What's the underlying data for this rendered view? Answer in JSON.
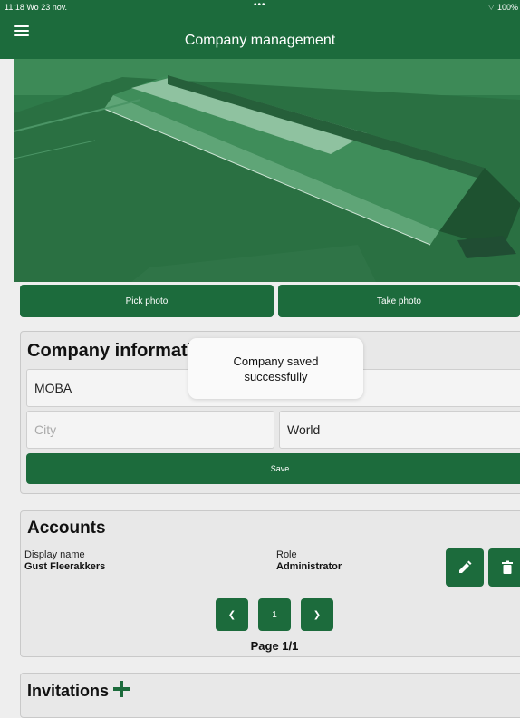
{
  "status_bar": {
    "time": "11:18  Wo 23 nov.",
    "dots": "•••",
    "battery": "100%"
  },
  "header": {
    "title": "Company management",
    "menu_icon": "hamburger-icon"
  },
  "photo": {
    "pick_label": "Pick photo",
    "take_label": "Take photo"
  },
  "company": {
    "title": "Company information",
    "name_value": "MOBA",
    "city_placeholder": "City",
    "country_value": "World",
    "save_label": "Save"
  },
  "toast": {
    "message": "Company saved successfully"
  },
  "accounts": {
    "title": "Accounts",
    "col_name": "Display name",
    "col_role": "Role",
    "rows": [
      {
        "name": "Gust Fleerakkers",
        "role": "Administrator"
      }
    ],
    "page_number": "1",
    "page_label": "Page 1/1",
    "edit_icon": "pencil-icon",
    "delete_icon": "trash-icon"
  },
  "invitations": {
    "title": "Invitations",
    "add_icon": "plus-icon"
  },
  "colors": {
    "brand": "#1c6b3c",
    "background": "#eeeeee"
  }
}
